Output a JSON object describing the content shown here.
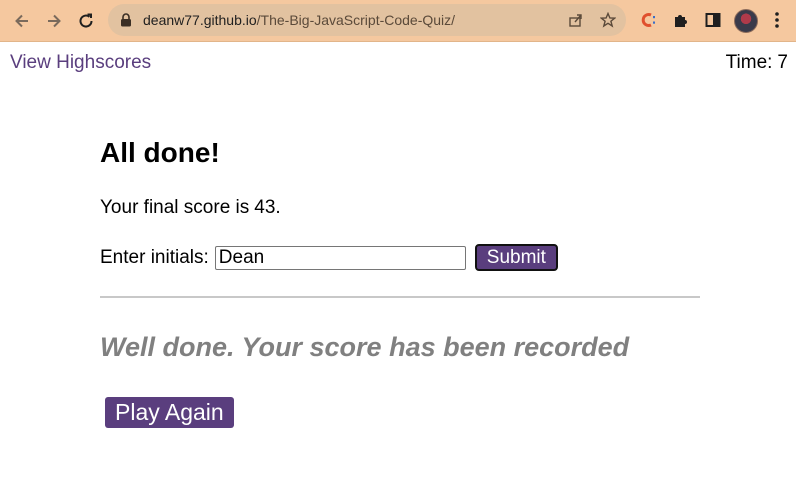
{
  "browser": {
    "url_host": "deanw77.github.io",
    "url_path": "/The-Big-JavaScript-Code-Quiz/",
    "icons": [
      "back-icon",
      "forward-icon",
      "reload-icon",
      "lock-icon",
      "share-icon",
      "star-icon",
      "extension-c-icon",
      "puzzle-icon",
      "side-panel-icon",
      "avatar",
      "menu-icon"
    ]
  },
  "header": {
    "highscores_link": "View Highscores",
    "timer_label": "Time:",
    "timer_value": "7"
  },
  "main": {
    "title": "All done!",
    "score_text": "Your final score is",
    "score_value": "43.",
    "initials_label": "Enter initials:",
    "initials_value": "Dean",
    "submit_label": "Submit",
    "feedback": "Well done. Your score has been recorded",
    "play_again_label": "Play Again"
  },
  "colors": {
    "toolbar": "#f5c89f",
    "accent": "#5a3e7e",
    "feedback": "#808080"
  }
}
